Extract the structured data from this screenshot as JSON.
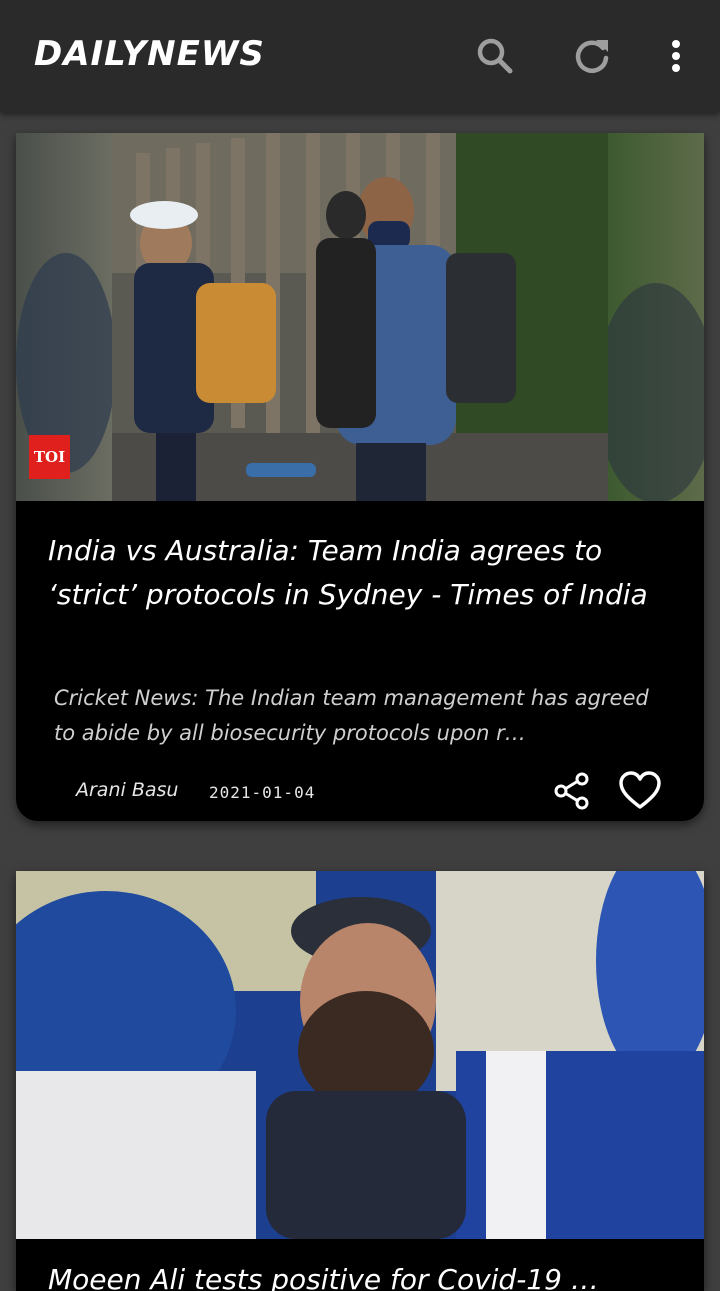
{
  "app": {
    "title": "DAILYNEWS",
    "accent": "#2a2a2a",
    "background": "#3f3f3f"
  },
  "toolbar": {
    "search_icon": "search-icon",
    "refresh_icon": "refresh-icon",
    "menu_icon": "more-vert-icon"
  },
  "articles": [
    {
      "source_badge": "TOI",
      "title": "India vs Australia: Team India agrees to ‘strict’ protocols in Sydney - Times of India",
      "description": "Cricket News: The Indian team management has agreed to abide by all biosecurity protocols upon r…",
      "author": "Arani Basu",
      "date": "2021-01-04",
      "share_icon": "share-icon",
      "like_icon": "heart-outline-icon"
    },
    {
      "title_partial": "Moeen Ali tests positive for Covid-19 …"
    }
  ]
}
